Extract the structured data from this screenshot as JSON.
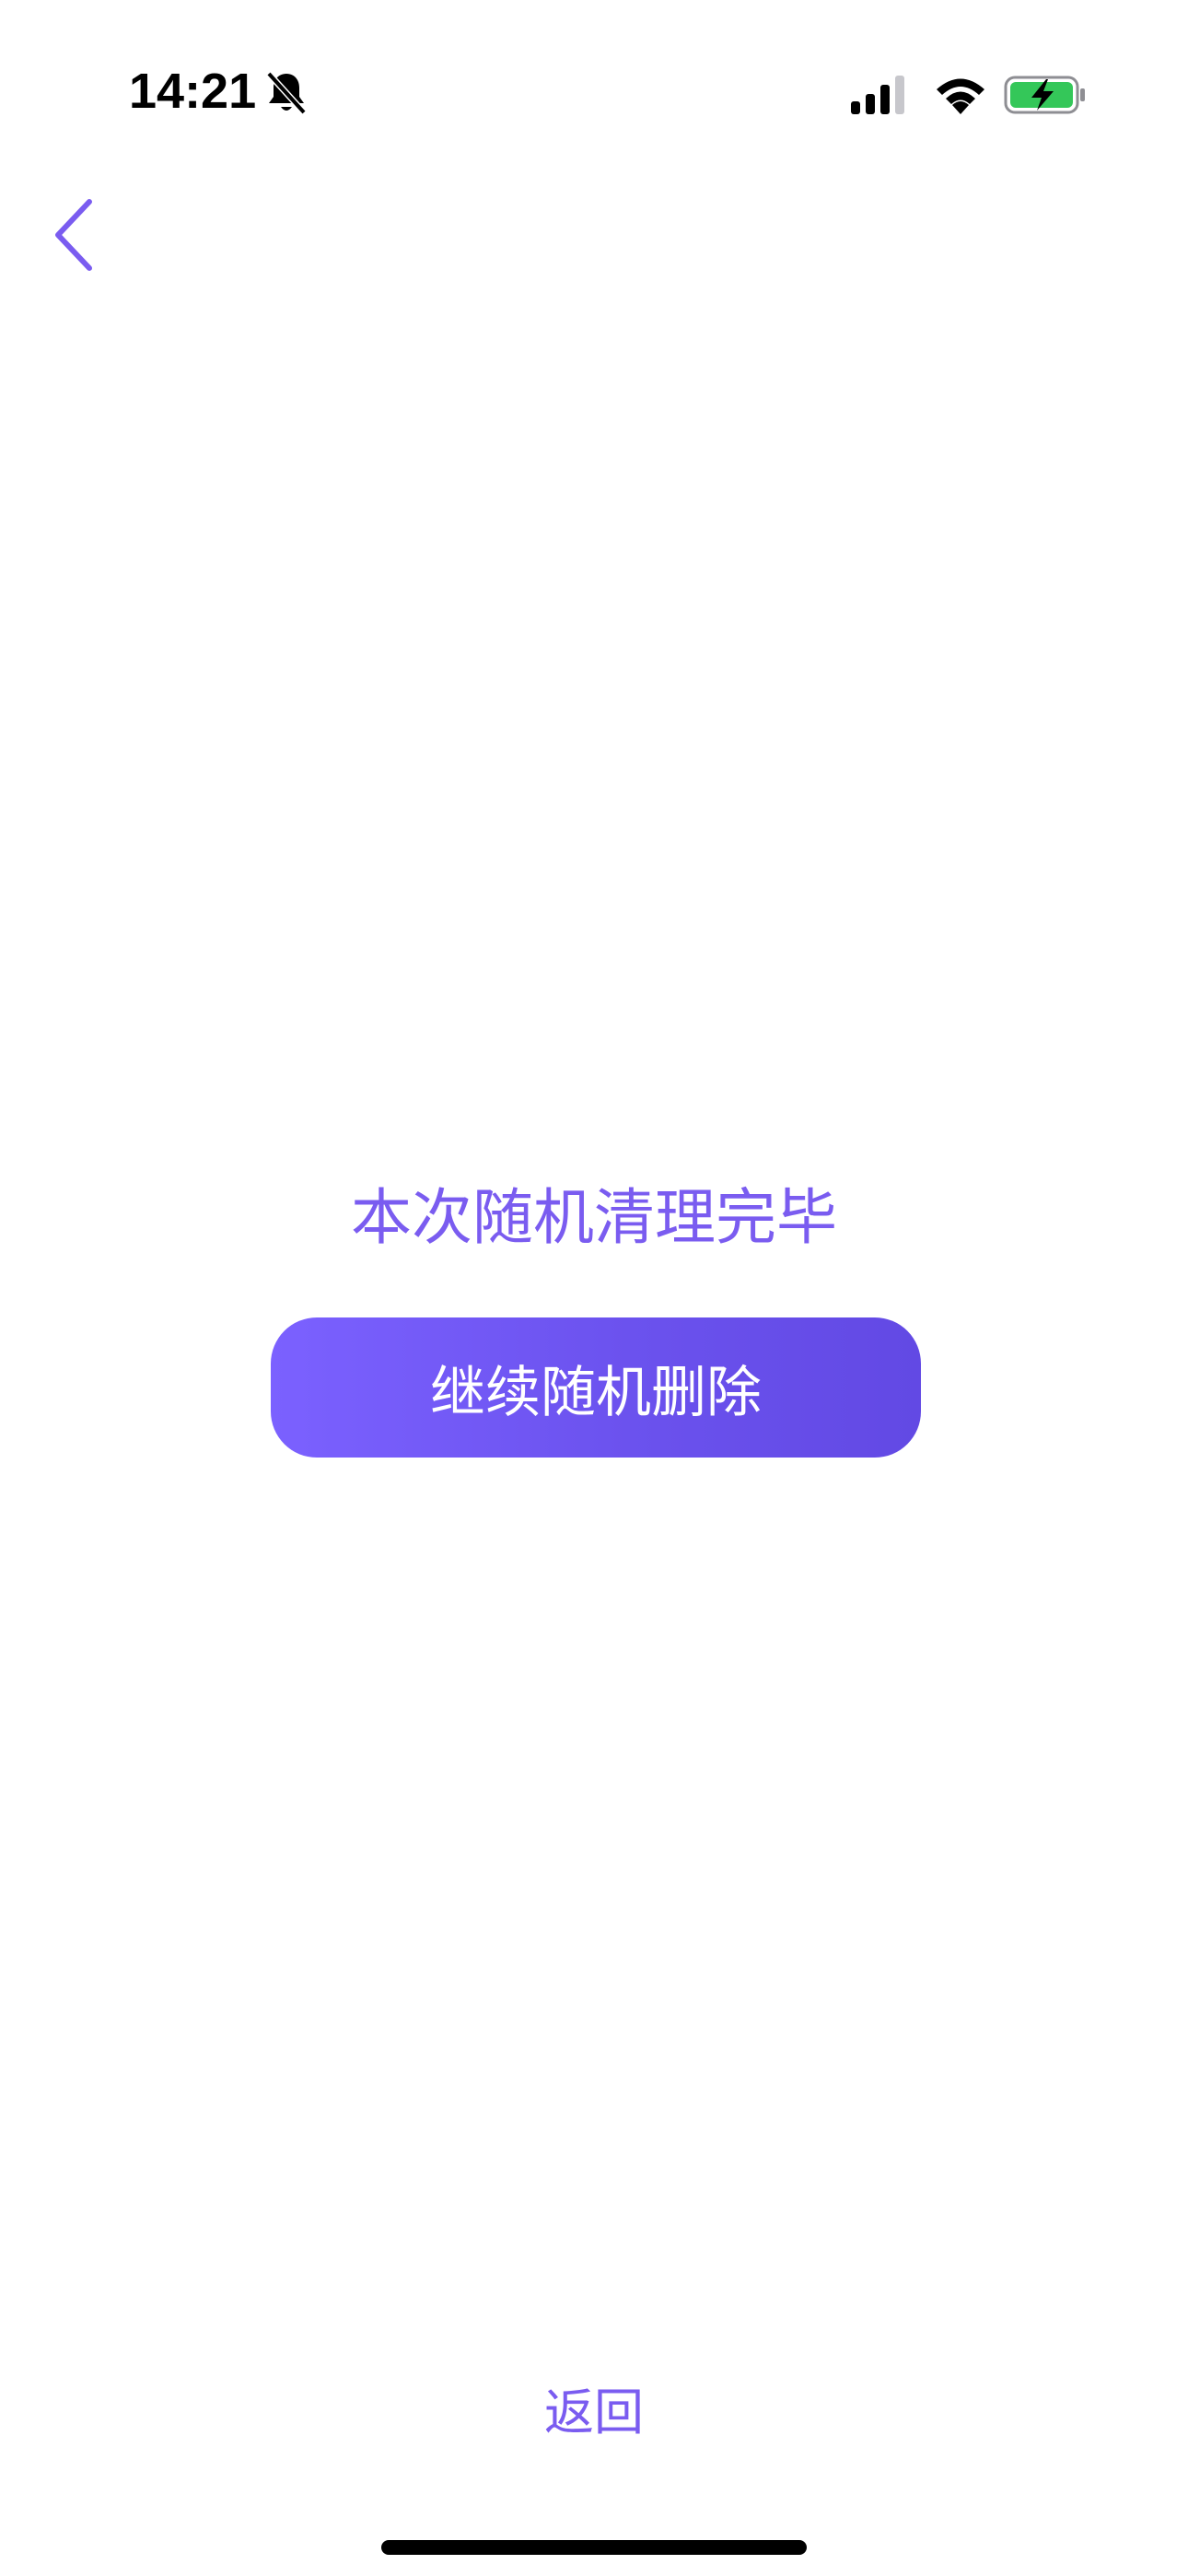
{
  "status_bar": {
    "time": "14:21",
    "icons": {
      "silent": "bell-slash-icon",
      "signal": "cellular-signal-icon",
      "wifi": "wifi-icon",
      "battery": "battery-charging-icon"
    }
  },
  "nav": {
    "back_icon": "chevron-left-icon"
  },
  "main": {
    "done_text": "本次随机清理完毕",
    "continue_label": "继续随机删除"
  },
  "footer": {
    "return_label": "返回"
  },
  "colors": {
    "accent": "#7a5cf0",
    "button_gradient_start": "#7b61ff",
    "button_gradient_end": "#6249e4",
    "battery_green": "#34c759"
  }
}
